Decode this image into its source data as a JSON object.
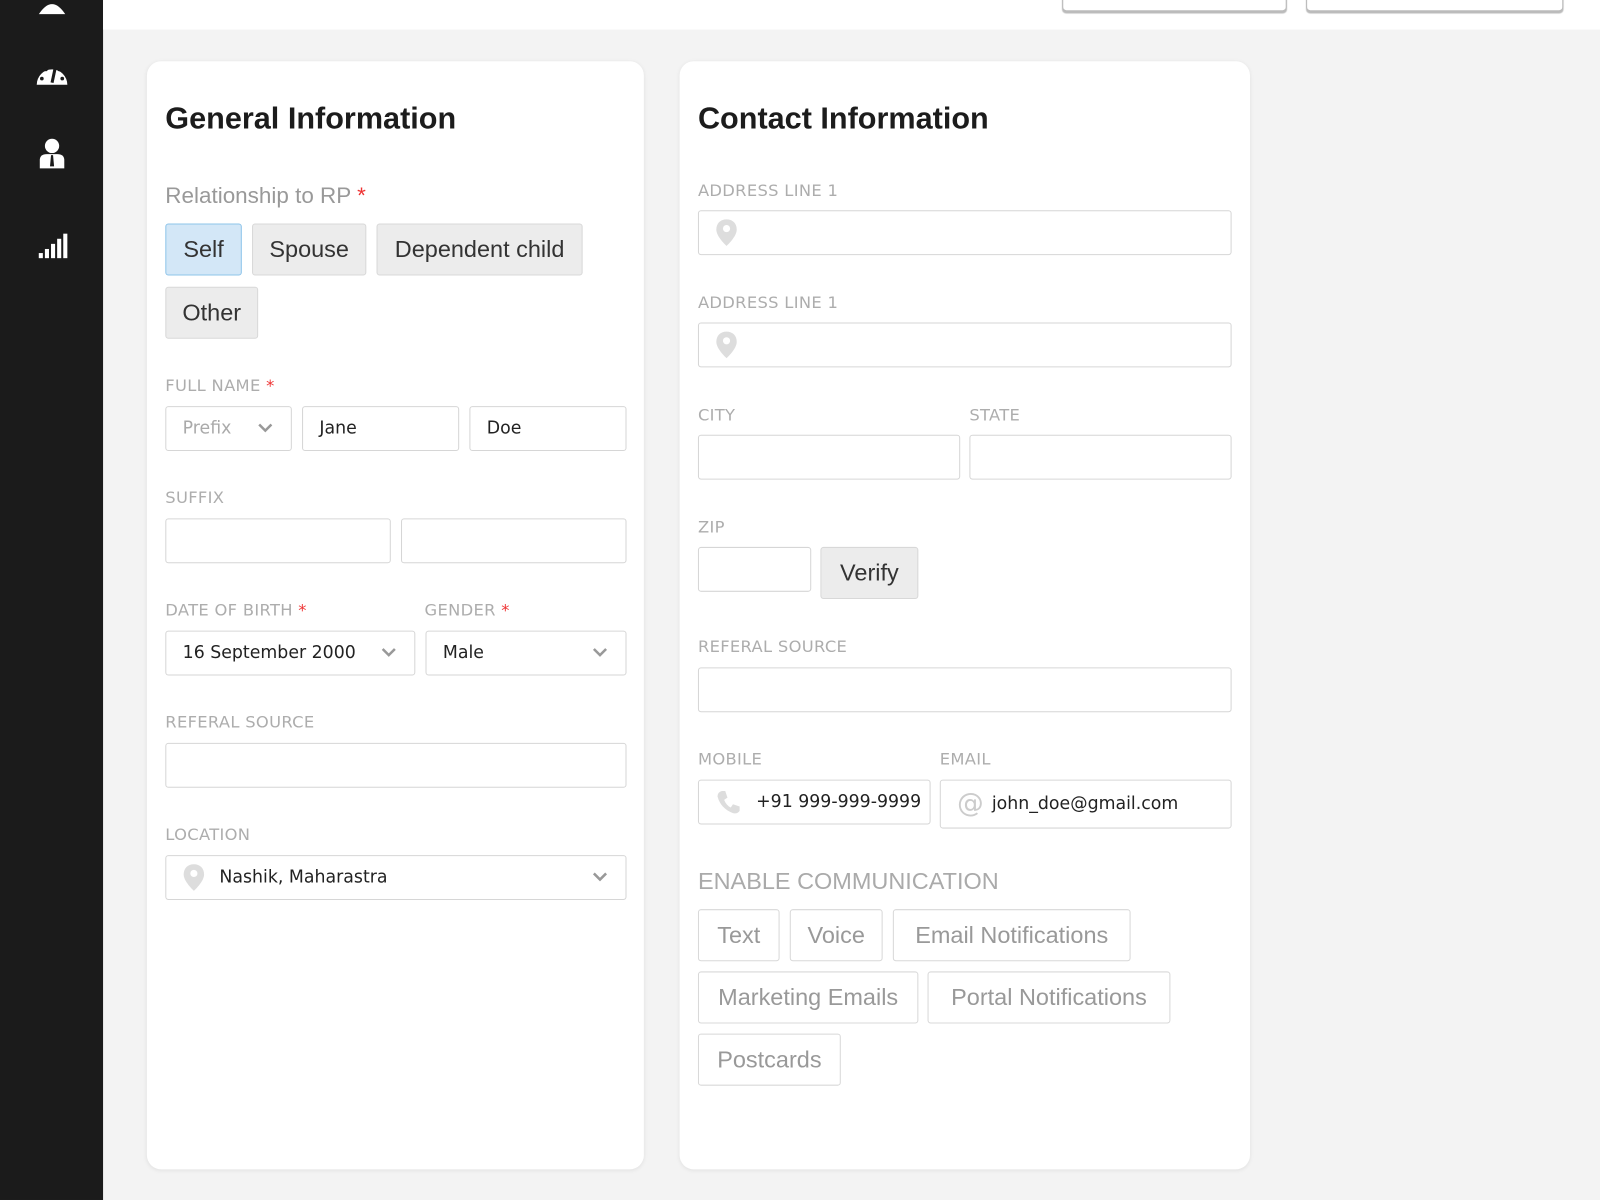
{
  "sidebar": {
    "items": [
      {
        "icon": "dashboard-gauge-icon"
      },
      {
        "icon": "user-icon"
      },
      {
        "icon": "signal-bars-icon"
      }
    ]
  },
  "general": {
    "title": "General Information",
    "relationship_label": "Relationship to RP",
    "relationship_options": [
      "Self",
      "Spouse",
      "Dependent child",
      "Other"
    ],
    "relationship_selected": "Self",
    "full_name_label": "FULL NAME",
    "prefix_placeholder": "Prefix",
    "first_name": "Jane",
    "last_name": "Doe",
    "suffix_label": "SUFFIX",
    "dob_label": "DATE OF BIRTH",
    "dob": "16 September 2000",
    "gender_label": "GENDER",
    "gender": "Male",
    "referral_label": "REFERAL SOURCE",
    "location_label": "LOCATION",
    "location": "Nashik, Maharastra",
    "required_mark": "*"
  },
  "contact": {
    "title": "Contact Information",
    "address1_label": "ADDRESS LINE 1",
    "address2_label": "ADDRESS LINE 1",
    "city_label": "CITY",
    "state_label": "STATE",
    "zip_label": "ZIP",
    "verify_label": "Verify",
    "referral_label": "REFERAL SOURCE",
    "mobile_label": "MOBILE",
    "mobile": "+91 999-999-9999",
    "email_label": "EMAIL",
    "email": "john_doe@gmail.com",
    "enable_label": "ENABLE COMMUNICATION",
    "options": [
      "Text",
      "Voice",
      "Email Notifications",
      "Marketing Emails",
      "Portal Notifications",
      "Postcards"
    ]
  }
}
